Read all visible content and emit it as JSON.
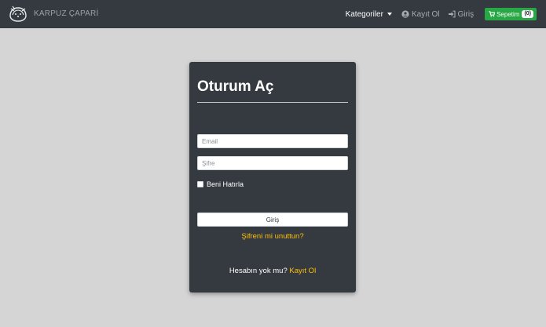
{
  "navbar": {
    "brand": "KARPUZ ÇAPARİ",
    "categories_label": "Kategoriler",
    "register_label": "Kayıt Ol",
    "login_label": "Giriş",
    "cart_label": "Sepetim",
    "cart_count": "(0)"
  },
  "login_card": {
    "title": "Oturum Aç",
    "email_placeholder": "Email",
    "password_placeholder": "Şifre",
    "remember_label": "Beni Hatırla",
    "submit_label": "Giriş",
    "forgot_label": "Şifreni mi unuttun?",
    "no_account_text": "Hesabın yok mu?",
    "register_link": "Kayıt Ol"
  },
  "colors": {
    "navbar_bg": "#343a40",
    "page_bg": "#d5d5d5",
    "accent_link": "#ffc107",
    "cart_green": "#28a745"
  },
  "icons": {
    "brand": "watermelon-logo-icon",
    "register": "user-circle-icon",
    "login": "sign-in-icon",
    "cart": "shopping-cart-icon",
    "dropdown": "caret-down-icon"
  }
}
